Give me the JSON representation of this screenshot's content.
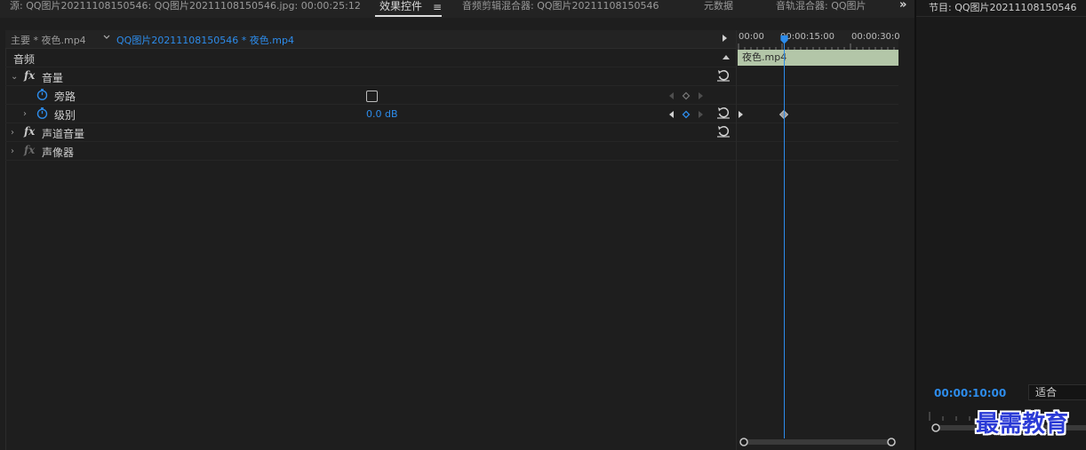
{
  "top_tabs": [
    {
      "label": "源: QQ图片20211108150546: QQ图片20211108150546.jpg: 00:00:25:12"
    },
    {
      "label": "效果控件"
    },
    {
      "label": "音频剪辑混合器: QQ图片20211108150546"
    },
    {
      "label": "元数据"
    },
    {
      "label": "音轨混合器: QQ图片"
    }
  ],
  "clip_tabs": {
    "master": "主要 * 夜色.mp4",
    "sequence": "QQ图片20211108150546 * 夜色.mp4"
  },
  "section_header": "音频",
  "effects": {
    "volume": {
      "name": "音量"
    },
    "bypass": {
      "name": "旁路",
      "checked": false
    },
    "level": {
      "name": "级别",
      "value": "0.0 dB"
    },
    "channel_volume": {
      "name": "声道音量"
    },
    "panner": {
      "name": "声像器"
    }
  },
  "timeline": {
    "ruler": [
      "00:00",
      "00:00:15:00",
      "00:00:30:0"
    ],
    "clip_name": "夜色.mp4",
    "clip_color": "#b3c6a8"
  },
  "program_monitor": {
    "title": "节目: QQ图片20211108150546",
    "timecode": "00:00:10:00",
    "fit": "适合"
  },
  "watermark": "最需教育",
  "colors": {
    "accent": "#2d8ceb",
    "clip": "#b3c6a8",
    "watermark": "#2b3bd6"
  }
}
